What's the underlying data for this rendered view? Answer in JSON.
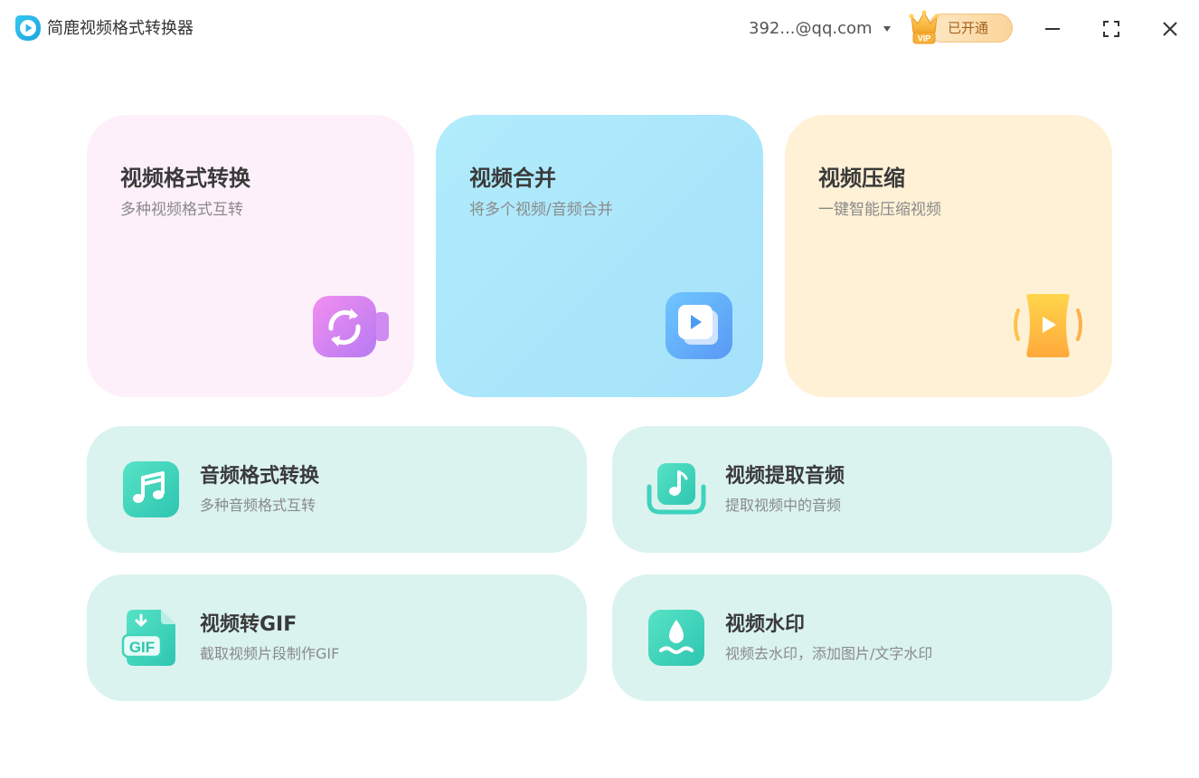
{
  "app": {
    "title": "简鹿视频格式转换器",
    "account": "392...@qq.com",
    "vip_badge": "VIP",
    "vip_status": "已开通"
  },
  "colors": {
    "logo": "#2bb5e8",
    "card_pink": "#fdf0fb",
    "card_blue": "#a9e6fb",
    "card_yellow": "#fff1d6",
    "card_mint": "#daf3ef",
    "icon_teal": "#3fd3bc",
    "vip_text": "#a4611d"
  },
  "features": {
    "video_convert": {
      "title": "视频格式转换",
      "desc": "多种视频格式互转",
      "icon": "video-convert-icon"
    },
    "video_merge": {
      "title": "视频合并",
      "desc": "将多个视频/音频合并",
      "icon": "video-merge-icon"
    },
    "video_compress": {
      "title": "视频压缩",
      "desc": "一键智能压缩视频",
      "icon": "video-compress-icon"
    },
    "audio_convert": {
      "title": "音频格式转换",
      "desc": "多种音频格式互转",
      "icon": "music-note-icon"
    },
    "extract_audio": {
      "title": "视频提取音频",
      "desc": "提取视频中的音频",
      "icon": "extract-audio-icon"
    },
    "video_gif": {
      "title": "视频转GIF",
      "desc": "截取视频片段制作GIF",
      "icon": "gif-file-icon",
      "icon_text": "GIF"
    },
    "watermark": {
      "title": "视频水印",
      "desc": "视频去水印，添加图片/文字水印",
      "icon": "water-drop-icon"
    }
  }
}
